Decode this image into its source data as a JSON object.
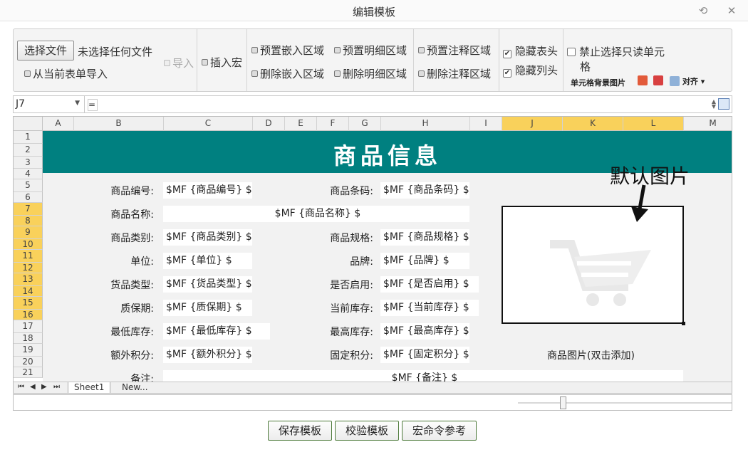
{
  "window": {
    "title": "编辑模板",
    "restore_glyph": "⟲",
    "close_glyph": "✕"
  },
  "ribbon": {
    "choose_file": "选择文件",
    "no_file": "未选择任何文件",
    "import_from_form": "从当前表单导入",
    "import": "导入",
    "insert_macro": "插入宏",
    "preset_embed_area": "预置嵌入区域",
    "delete_embed_area": "删除嵌入区域",
    "preset_detail_area": "预置明细区域",
    "delete_detail_area": "删除明细区域",
    "preset_note_area": "预置注释区域",
    "delete_note_area": "删除注释区域",
    "hide_header": "隐藏表头",
    "hide_column_header": "隐藏列头",
    "hide_header_checked": true,
    "hide_column_header_checked": true,
    "forbid_readonly_line1": "禁止选择只读单元",
    "forbid_readonly_line2": "格",
    "cell_bg_image": "单元格背景图片",
    "align": "对齐",
    "align_arrow": "▾",
    "check_glyph": "✔"
  },
  "formula_bar": {
    "cell_ref": "J7",
    "arrow": "▼",
    "value": "="
  },
  "sheet": {
    "columns": [
      "A",
      "B",
      "C",
      "D",
      "E",
      "F",
      "G",
      "H",
      "I",
      "J",
      "K",
      "L",
      "M"
    ],
    "selected_columns": [
      "J",
      "K",
      "L"
    ],
    "rows": [
      "1",
      "2",
      "3",
      "4",
      "5",
      "6",
      "7",
      "8",
      "9",
      "10",
      "11",
      "12",
      "13",
      "14",
      "15",
      "16",
      "17",
      "18",
      "19",
      "20",
      "21"
    ],
    "selected_rows": [
      "7",
      "8",
      "9",
      "10",
      "11",
      "12",
      "13",
      "14",
      "15",
      "16"
    ],
    "banner_title": "商品信息",
    "fields": {
      "product_code_label": "商品编号:",
      "product_code_value": "$MF {商品编号} $",
      "barcode_label": "商品条码:",
      "barcode_value": "$MF {商品条码} $",
      "product_name_label": "商品名称:",
      "product_name_value": "$MF {商品名称} $",
      "category_label": "商品类别:",
      "category_value": "$MF {商品类别} $",
      "spec_label": "商品规格:",
      "spec_value": "$MF {商品规格} $",
      "unit_label": "单位:",
      "unit_value": "$MF {单位} $",
      "brand_label": "品牌:",
      "brand_value": "$MF {品牌} $",
      "goods_type_label": "货品类型:",
      "goods_type_value": "$MF {货品类型} $",
      "enabled_label": "是否启用:",
      "enabled_value": "$MF {是否启用} $",
      "shelf_life_label": "质保期:",
      "shelf_life_value": "$MF {质保期} $",
      "stock_label": "当前库存:",
      "stock_value": "$MF {当前库存} $",
      "min_stock_label": "最低库存:",
      "min_stock_value": "$MF {最低库存} $",
      "max_stock_label": "最高库存:",
      "max_stock_value": "$MF {最高库存} $",
      "extra_points_label": "额外积分:",
      "extra_points_value": "$MF {额外积分} $",
      "fixed_points_label": "固定积分:",
      "fixed_points_value": "$MF {固定积分} $",
      "remark_label": "备注:",
      "remark_value": "$MF {备注} $"
    },
    "image_caption": "商品图片(双击添加)",
    "annotation": "默认图片",
    "tabs": [
      "Sheet1",
      "New..."
    ],
    "nav": [
      "⏮",
      "◀",
      "▶",
      "⏭"
    ],
    "banner_color": "#008080",
    "selection_color": "#f9d15b"
  },
  "footer": {
    "save": "保存模板",
    "validate": "校验模板",
    "macro_ref": "宏命令参考"
  }
}
